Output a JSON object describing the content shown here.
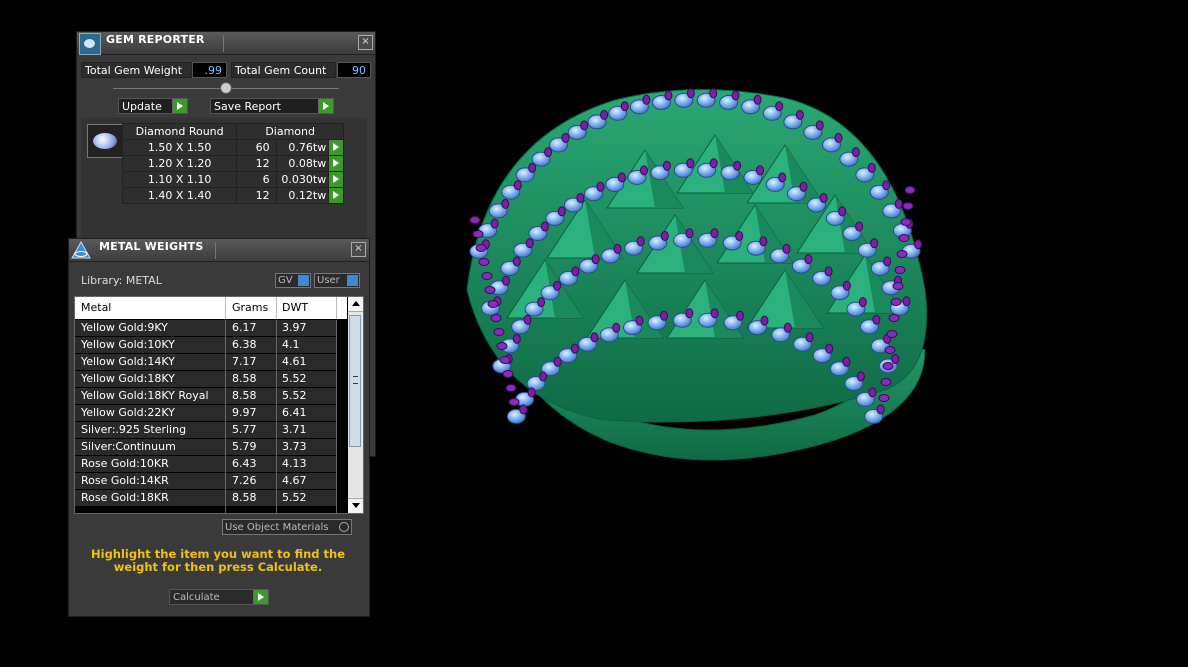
{
  "gem_reporter": {
    "title": "GEM REPORTER",
    "total_weight_label": "Total Gem Weight",
    "total_weight_value": ".99",
    "total_count_label": "Total Gem Count",
    "total_count_value": "90",
    "update_label": "Update",
    "save_report_label": "Save Report",
    "table": {
      "header_shape": "Diamond Round",
      "header_type": "Diamond",
      "rows": [
        {
          "size": "1.50 X 1.50",
          "count": "60",
          "weight": "0.76tw"
        },
        {
          "size": "1.20 X 1.20",
          "count": "12",
          "weight": "0.08tw"
        },
        {
          "size": "1.10 X 1.10",
          "count": "6",
          "weight": "0.030tw"
        },
        {
          "size": "1.40 X 1.40",
          "count": "12",
          "weight": "0.12tw"
        }
      ]
    }
  },
  "metal_weights": {
    "title": "METAL WEIGHTS",
    "library_label": "Library: METAL",
    "gv_label": "GV",
    "user_label": "User",
    "columns": [
      "Metal",
      "Grams",
      "DWT"
    ],
    "rows": [
      {
        "metal": "Yellow Gold:9KY",
        "grams": "6.17",
        "dwt": "3.97"
      },
      {
        "metal": "Yellow Gold:10KY",
        "grams": "6.38",
        "dwt": "4.1"
      },
      {
        "metal": "Yellow Gold:14KY",
        "grams": "7.17",
        "dwt": "4.61"
      },
      {
        "metal": "Yellow Gold:18KY",
        "grams": "8.58",
        "dwt": "5.52"
      },
      {
        "metal": "Yellow Gold:18KY Royal",
        "grams": "8.58",
        "dwt": "5.52"
      },
      {
        "metal": "Yellow Gold:22KY",
        "grams": "9.97",
        "dwt": "6.41"
      },
      {
        "metal": "Silver:.925 Sterling",
        "grams": "5.77",
        "dwt": "3.71"
      },
      {
        "metal": "Silver:Continuum",
        "grams": "5.79",
        "dwt": "3.73"
      },
      {
        "metal": "Rose Gold:10KR",
        "grams": "6.43",
        "dwt": "4.13"
      },
      {
        "metal": "Rose Gold:14KR",
        "grams": "7.26",
        "dwt": "4.67"
      },
      {
        "metal": "Rose Gold:18KR",
        "grams": "8.58",
        "dwt": "5.52"
      }
    ],
    "use_object_materials_label": "Use Object Materials",
    "help_text": "Highlight the item you want to find the weight for then press Calculate.",
    "calculate_label": "Calculate"
  },
  "colors": {
    "metal": "#1e8f5f",
    "gem": "#6fa8f0",
    "prong": "#7a1fa6",
    "accent_green": "#3c9a2a",
    "help_text": "#f2c010"
  }
}
